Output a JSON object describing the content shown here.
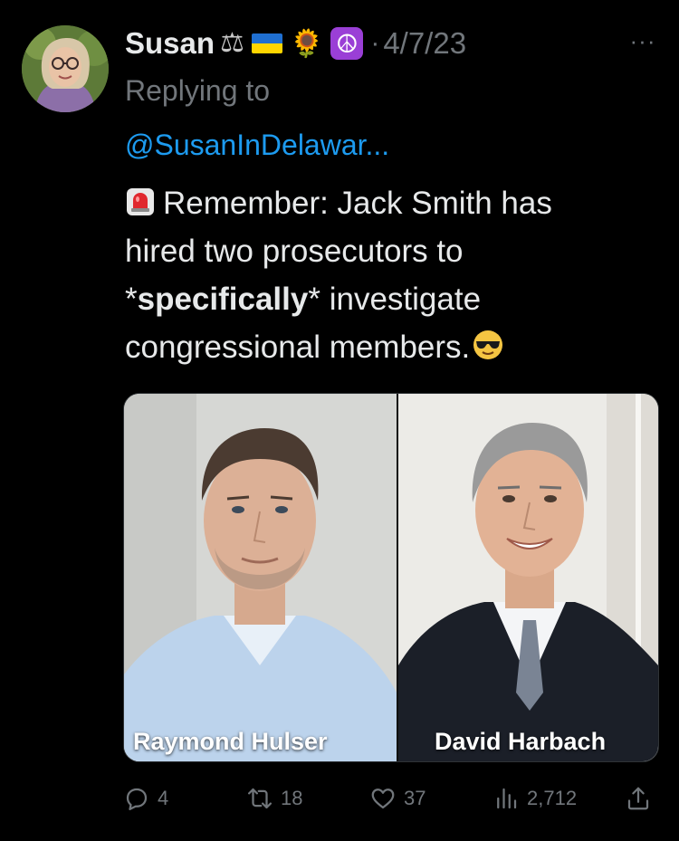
{
  "tweet": {
    "author": {
      "display_name": "Susan",
      "name_emojis": [
        "scales-emoji",
        "ukraine-flag-emoji",
        "sunflower-emoji",
        "peace-symbol-emoji"
      ]
    },
    "separator": "·",
    "timestamp": "4/7/23",
    "more_label": "···",
    "replying_label": "Replying to",
    "replying_handle": "@SusanInDelawar...",
    "text": {
      "line1": "Remember: Jack Smith has",
      "line2": "hired two prosecutors to",
      "line3_pre": "*",
      "line3_bold": "specifically",
      "line3_post": "* investigate",
      "line4": "congressional members."
    },
    "text_icons": [
      "siren-emoji",
      "sunglasses-emoji"
    ],
    "media": {
      "left_caption": "Raymond Hulser",
      "right_caption": "David Harbach"
    },
    "actions": {
      "replies": "4",
      "retweets": "18",
      "likes": "37",
      "views": "2,712"
    }
  },
  "colors": {
    "background": "#000000",
    "primary_text": "#e7e9ea",
    "secondary_text": "#71767b",
    "link": "#1d9bf0"
  }
}
